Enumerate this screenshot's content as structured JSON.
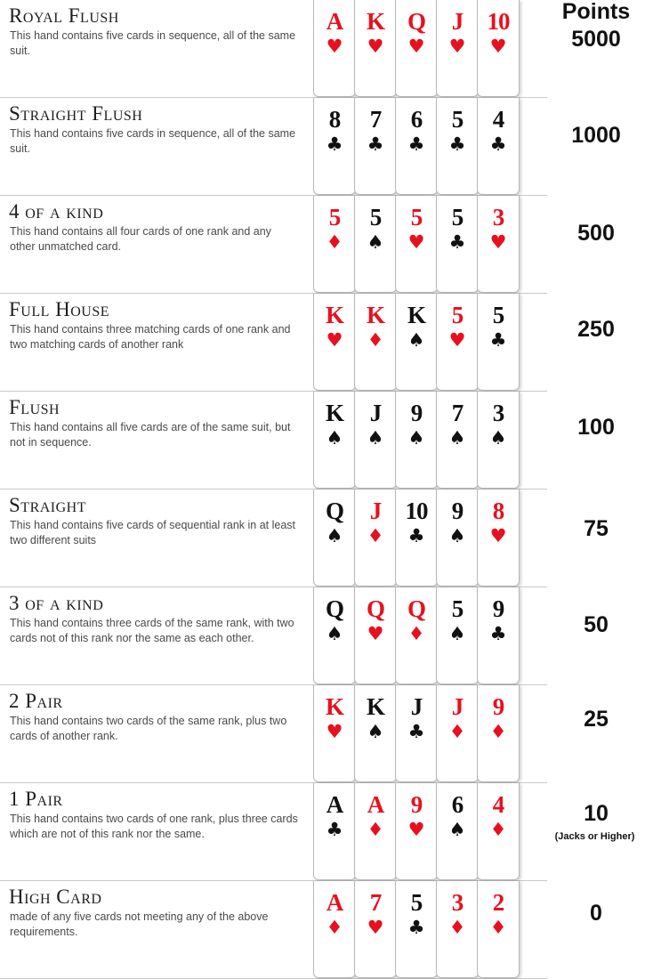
{
  "points_header": "Points",
  "suit_glyphs": {
    "hearts": "♥",
    "diamonds": "♦",
    "spades": "♠",
    "clubs": "♣"
  },
  "colors": {
    "red_suit": "#e8101e",
    "black_suit": "#111111",
    "divider": "#c9c9c9"
  },
  "hands": [
    {
      "name": "Royal Flush",
      "description": "This hand contains five cards in sequence, all of the same suit.",
      "points": "5000",
      "note": "",
      "cards": [
        {
          "rank": "A",
          "suit": "hearts"
        },
        {
          "rank": "K",
          "suit": "hearts"
        },
        {
          "rank": "Q",
          "suit": "hearts"
        },
        {
          "rank": "J",
          "suit": "hearts"
        },
        {
          "rank": "10",
          "suit": "hearts"
        }
      ]
    },
    {
      "name": "Straight Flush",
      "description": "This hand contains five cards in sequence, all of the same suit.",
      "points": "1000",
      "note": "",
      "cards": [
        {
          "rank": "8",
          "suit": "clubs"
        },
        {
          "rank": "7",
          "suit": "clubs"
        },
        {
          "rank": "6",
          "suit": "clubs"
        },
        {
          "rank": "5",
          "suit": "clubs"
        },
        {
          "rank": "4",
          "suit": "clubs"
        }
      ]
    },
    {
      "name": "4 of a kind",
      "description": "This hand contains all four cards of one rank and any other unmatched card.",
      "points": "500",
      "note": "",
      "cards": [
        {
          "rank": "5",
          "suit": "diamonds"
        },
        {
          "rank": "5",
          "suit": "spades"
        },
        {
          "rank": "5",
          "suit": "hearts"
        },
        {
          "rank": "5",
          "suit": "clubs"
        },
        {
          "rank": "3",
          "suit": "hearts"
        }
      ]
    },
    {
      "name": "Full House",
      "description": "This hand contains three matching cards of one rank and two matching cards of another rank",
      "points": "250",
      "note": "",
      "cards": [
        {
          "rank": "K",
          "suit": "hearts"
        },
        {
          "rank": "K",
          "suit": "diamonds"
        },
        {
          "rank": "K",
          "suit": "spades"
        },
        {
          "rank": "5",
          "suit": "hearts"
        },
        {
          "rank": "5",
          "suit": "clubs"
        }
      ]
    },
    {
      "name": "Flush",
      "description": "This hand contains all five cards are of the same suit, but not in sequence.",
      "points": "100",
      "note": "",
      "cards": [
        {
          "rank": "K",
          "suit": "spades"
        },
        {
          "rank": "J",
          "suit": "spades"
        },
        {
          "rank": "9",
          "suit": "spades"
        },
        {
          "rank": "7",
          "suit": "spades"
        },
        {
          "rank": "3",
          "suit": "spades"
        }
      ]
    },
    {
      "name": "Straight",
      "description": "This hand contains five cards of sequential rank in at least two different suits",
      "points": "75",
      "note": "",
      "cards": [
        {
          "rank": "Q",
          "suit": "spades"
        },
        {
          "rank": "J",
          "suit": "diamonds"
        },
        {
          "rank": "10",
          "suit": "clubs"
        },
        {
          "rank": "9",
          "suit": "spades"
        },
        {
          "rank": "8",
          "suit": "hearts"
        }
      ]
    },
    {
      "name": "3 of a kind",
      "description": "This hand contains three cards of the same rank, with two cards not of this rank nor the same as each other.",
      "points": "50",
      "note": "",
      "cards": [
        {
          "rank": "Q",
          "suit": "spades"
        },
        {
          "rank": "Q",
          "suit": "hearts"
        },
        {
          "rank": "Q",
          "suit": "diamonds"
        },
        {
          "rank": "5",
          "suit": "spades"
        },
        {
          "rank": "9",
          "suit": "clubs"
        }
      ]
    },
    {
      "name": "2 Pair",
      "description": "This hand contains two cards of the same rank, plus two cards of another rank.",
      "points": "25",
      "note": "",
      "cards": [
        {
          "rank": "K",
          "suit": "hearts"
        },
        {
          "rank": "K",
          "suit": "spades"
        },
        {
          "rank": "J",
          "suit": "clubs"
        },
        {
          "rank": "J",
          "suit": "diamonds"
        },
        {
          "rank": "9",
          "suit": "diamonds"
        }
      ]
    },
    {
      "name": "1 Pair",
      "description": "This hand contains two cards of one rank, plus three cards which are not of this rank nor the same.",
      "points": "10",
      "note": "(Jacks or Higher)",
      "cards": [
        {
          "rank": "A",
          "suit": "clubs"
        },
        {
          "rank": "A",
          "suit": "diamonds"
        },
        {
          "rank": "9",
          "suit": "hearts"
        },
        {
          "rank": "6",
          "suit": "spades"
        },
        {
          "rank": "4",
          "suit": "diamonds"
        }
      ]
    },
    {
      "name": "High Card",
      "description": "made of any five cards not meeting any of the above requirements.",
      "points": "0",
      "note": "",
      "cards": [
        {
          "rank": "A",
          "suit": "diamonds"
        },
        {
          "rank": "7",
          "suit": "hearts"
        },
        {
          "rank": "5",
          "suit": "clubs"
        },
        {
          "rank": "3",
          "suit": "diamonds"
        },
        {
          "rank": "2",
          "suit": "diamonds"
        }
      ]
    }
  ]
}
